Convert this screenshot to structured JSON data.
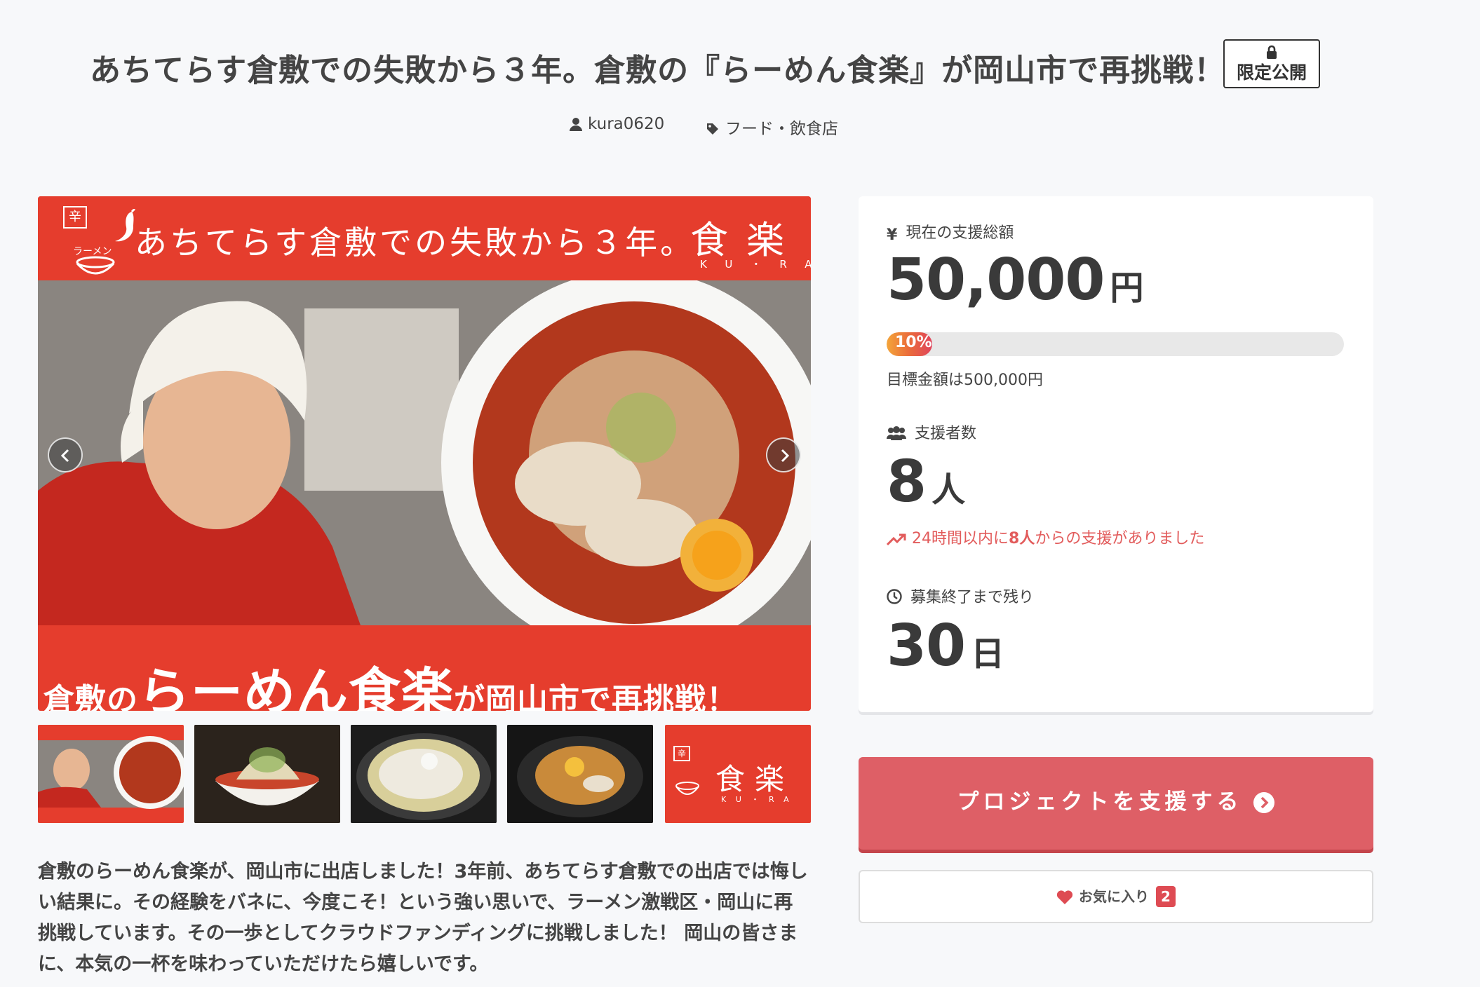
{
  "project": {
    "title": "あちてらす倉敷での失敗から３年。倉敷の『らーめん食楽』が岡山市で再挑戦！",
    "visibility_badge": "限定公開",
    "owner": "kura0620",
    "category": "フード・飲食店"
  },
  "hero": {
    "logo_mark": "辛",
    "logo_sub": "ラーメン",
    "banner_text": "あちてらす倉敷での失敗から３年。",
    "brand": "食楽",
    "brand_romaji": "KU・RA",
    "bottom_prefix": "倉敷の",
    "bottom_highlight": "らーめん食楽",
    "bottom_suffix": "が岡山市で再挑戦！"
  },
  "carousel": {
    "prev_icon": "chevron-left-icon",
    "next_icon": "chevron-right-icon"
  },
  "thumbnails": [
    {
      "alt": "hero-banner-thumbnail"
    },
    {
      "alt": "ramen-bowl-side-thumbnail"
    },
    {
      "alt": "noodles-mayo-thumbnail"
    },
    {
      "alt": "soupless-noodles-thumbnail"
    },
    {
      "alt": "logo-thumbnail",
      "brand": "食楽",
      "brand_romaji": "KU・RA",
      "logo_mark": "辛"
    }
  ],
  "description": "倉敷のらーめん食楽が、岡山市に出店しました！3年前、あちてらす倉敷での出店では悔しい結果に。その経験をバネに、今度こそ！という強い思いで、ラーメン激戦区・岡山に再挑戦しています。その一歩としてクラウドファンディングに挑戦しました！ 岡山の皆さまに、本気の一杯を味わっていただけたら嬉しいです。",
  "stats": {
    "funded_label": "現在の支援総額",
    "funded_amount": "50,000",
    "funded_unit": "円",
    "progress_percent": 10,
    "progress_label": "10%",
    "goal_text": "目標金額は500,000円",
    "backers_label": "支援者数",
    "backers_count": "8",
    "backers_unit": "人",
    "recent_prefix": "24時間以内に",
    "recent_count": "8人",
    "recent_suffix": "からの支援がありました",
    "remaining_label": "募集終了まで残り",
    "remaining_days": "30",
    "remaining_unit": "日"
  },
  "actions": {
    "support_label": "プロジェクトを支援する",
    "favorite_label": "お気に入り",
    "favorite_count": "2"
  },
  "colors": {
    "accent": "#de5f66",
    "hero_red": "#e53d2d",
    "trend": "#e25b5b"
  }
}
